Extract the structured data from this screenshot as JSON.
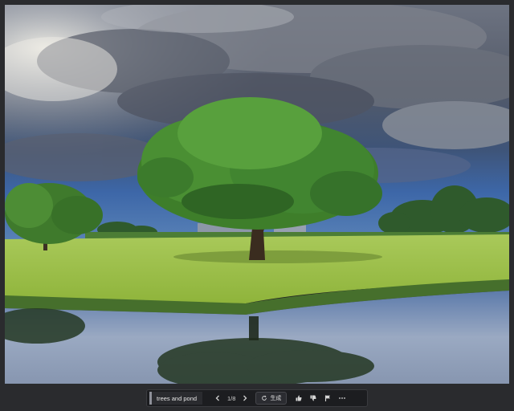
{
  "toolbar": {
    "prompt_text": "trees and pond",
    "pager_text": "1/8",
    "generate_label": "生成"
  },
  "icons": {
    "prev": "chevron-left-icon",
    "next": "chevron-right-icon",
    "regenerate": "refresh-icon",
    "like": "thumbs-up-icon",
    "dislike": "thumbs-down-icon",
    "flag": "flag-icon",
    "more": "more-horizontal-icon"
  },
  "colors": {
    "background": "#2a2b2e",
    "toolbar_bg": "#1c1d20",
    "text": "#d8d8d8"
  }
}
